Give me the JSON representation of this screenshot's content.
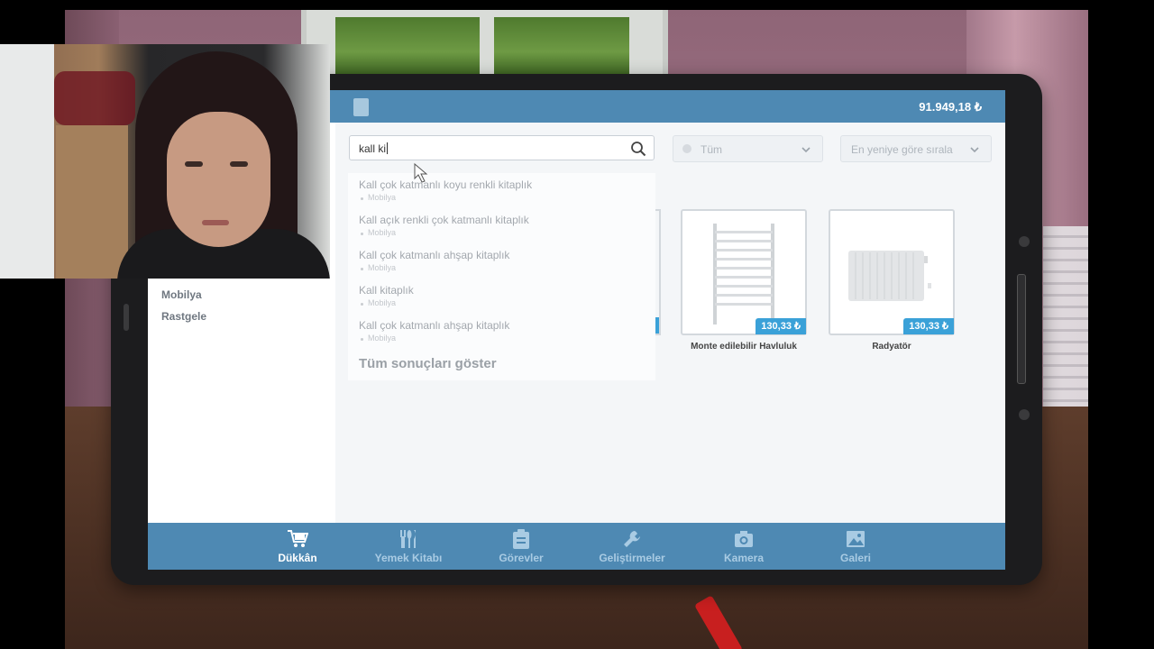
{
  "app": {
    "balance": "91.949,18 ₺"
  },
  "sidebar": {
    "items": [
      {
        "label": "Mobilya"
      },
      {
        "label": "Rastgele"
      }
    ]
  },
  "search": {
    "value": "kall ki",
    "suggestions": [
      {
        "title": "Kall çok katmanlı koyu renkli kitaplık",
        "category": "Mobilya"
      },
      {
        "title": "Kall açık renkli çok katmanlı kitaplık",
        "category": "Mobilya"
      },
      {
        "title": "Kall çok katmanlı ahşap kitaplık",
        "category": "Mobilya"
      },
      {
        "title": "Kall kitaplık",
        "category": "Mobilya"
      },
      {
        "title": "Kall çok katmanlı ahşap kitaplık",
        "category": "Mobilya"
      }
    ],
    "show_all": "Tüm sonuçları göster"
  },
  "filters": {
    "category": "Tüm",
    "sort": "En yeniye göre sırala"
  },
  "products": [
    {
      "name": "Monte edilebilir Havluluk",
      "price": "130,33 ₺"
    },
    {
      "name": "Radyatör",
      "price": "130,33 ₺"
    }
  ],
  "nav": {
    "items": [
      {
        "label": "Dükkân",
        "icon": "cart-icon",
        "active": true
      },
      {
        "label": "Yemek Kitabı",
        "icon": "cutlery-icon",
        "active": false
      },
      {
        "label": "Görevler",
        "icon": "clipboard-icon",
        "active": false
      },
      {
        "label": "Geliştirmeler",
        "icon": "wrench-icon",
        "active": false
      },
      {
        "label": "Kamera",
        "icon": "camera-icon",
        "active": false
      },
      {
        "label": "Galeri",
        "icon": "image-icon",
        "active": false
      }
    ]
  },
  "colors": {
    "bar": "#4e89b3",
    "price_tag": "#3aa1d8"
  }
}
